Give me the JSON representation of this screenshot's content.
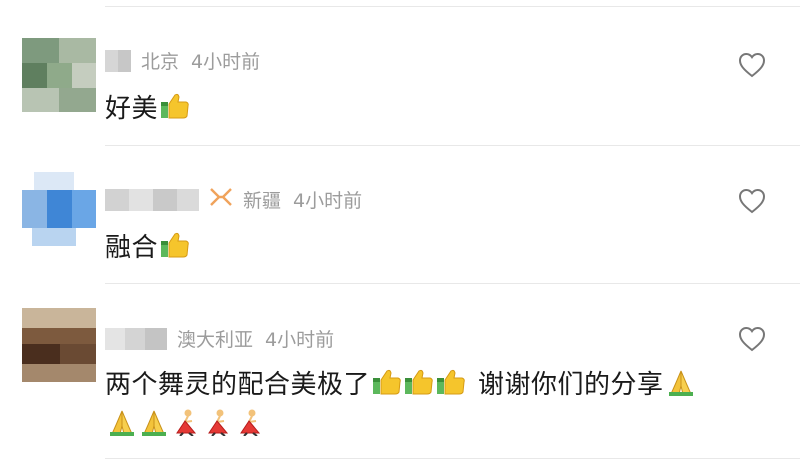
{
  "comments": [
    {
      "location": "北京",
      "time": "4小时前",
      "text": "好美",
      "emojis": [
        "thumbs-up"
      ]
    },
    {
      "location": "新疆",
      "time": "4小时前",
      "text": "融合",
      "emojis": [
        "thumbs-up"
      ],
      "badge_icon": "ribbon-badge-icon"
    },
    {
      "location": "澳大利亚",
      "time": "4小时前",
      "text": "两个舞灵的配合美极了",
      "text2": "谢谢你们的分享",
      "emojis": [
        "thumbs-up",
        "thumbs-up",
        "thumbs-up",
        "folded-hands",
        "folded-hands",
        "folded-hands",
        "dancer",
        "dancer",
        "dancer"
      ]
    }
  ],
  "colors": {
    "meta_gray": "#9c9c9c",
    "text": "#1a1a1a",
    "badge_orange": "#f0a35b",
    "divider": "#e8e8e8"
  }
}
